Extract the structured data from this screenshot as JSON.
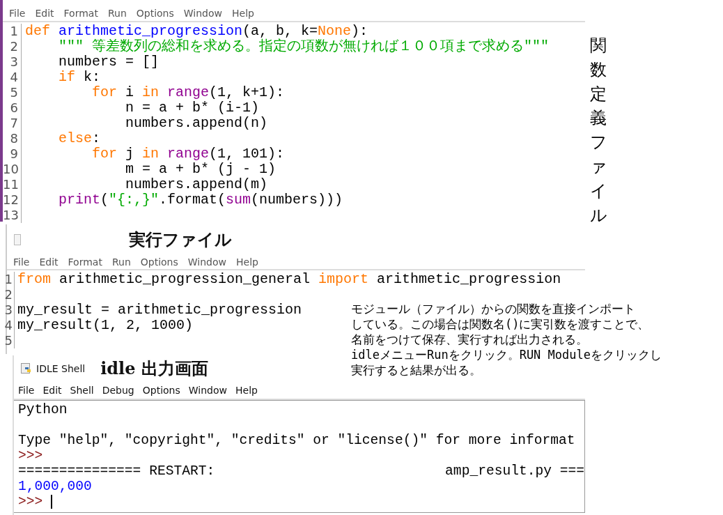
{
  "definition_window": {
    "menu": [
      "File",
      "Edit",
      "Format",
      "Run",
      "Options",
      "Window",
      "Help"
    ],
    "lines": [
      {
        "number": "1",
        "tokens": [
          {
            "kind": "keyword",
            "text": "def"
          },
          {
            "kind": "defname",
            "text": " arithmetic_progression"
          },
          {
            "kind": "plain",
            "text": "(a, b, k="
          },
          {
            "kind": "keyword",
            "text": "None"
          },
          {
            "kind": "plain",
            "text": "):"
          }
        ]
      },
      {
        "number": "2",
        "tokens": [
          {
            "kind": "string",
            "text": "    \"\"\" 等差数列の総和を求める。指定の項数が無ければ１００項まで求める\"\"\""
          }
        ]
      },
      {
        "number": "3",
        "tokens": [
          {
            "kind": "plain",
            "text": "    numbers = []"
          }
        ]
      },
      {
        "number": "4",
        "tokens": [
          {
            "kind": "keyword",
            "text": "    if"
          },
          {
            "kind": "plain",
            "text": " k:"
          }
        ]
      },
      {
        "number": "5",
        "tokens": [
          {
            "kind": "keyword",
            "text": "        for"
          },
          {
            "kind": "plain",
            "text": " i "
          },
          {
            "kind": "keyword",
            "text": "in"
          },
          {
            "kind": "builtin",
            "text": " range"
          },
          {
            "kind": "plain",
            "text": "(1, k+1):"
          }
        ]
      },
      {
        "number": "6",
        "tokens": [
          {
            "kind": "plain",
            "text": "            n = a + b* (i-1)"
          }
        ]
      },
      {
        "number": "7",
        "tokens": [
          {
            "kind": "plain",
            "text": "            numbers.append(n)"
          }
        ]
      },
      {
        "number": "8",
        "tokens": [
          {
            "kind": "keyword",
            "text": "    else"
          },
          {
            "kind": "plain",
            "text": ":"
          }
        ]
      },
      {
        "number": "9",
        "tokens": [
          {
            "kind": "keyword",
            "text": "        for"
          },
          {
            "kind": "plain",
            "text": " j "
          },
          {
            "kind": "keyword",
            "text": "in"
          },
          {
            "kind": "builtin",
            "text": " range"
          },
          {
            "kind": "plain",
            "text": "(1, 101):"
          }
        ]
      },
      {
        "number": "10",
        "tokens": [
          {
            "kind": "plain",
            "text": "            m = a + b* (j - 1)"
          }
        ]
      },
      {
        "number": "11",
        "tokens": [
          {
            "kind": "plain",
            "text": "            numbers.append(m)"
          }
        ]
      },
      {
        "number": "12",
        "tokens": [
          {
            "kind": "builtin",
            "text": "    print"
          },
          {
            "kind": "plain",
            "text": "("
          },
          {
            "kind": "string",
            "text": "\"{:,}\""
          },
          {
            "kind": "plain",
            "text": ".format("
          },
          {
            "kind": "builtin",
            "text": "sum"
          },
          {
            "kind": "plain",
            "text": "(numbers)))"
          }
        ]
      },
      {
        "number": "13"
      }
    ]
  },
  "definition_label": "関数定義ファイル",
  "run_window": {
    "title": "実行ファイル",
    "menu": [
      "File",
      "Edit",
      "Format",
      "Run",
      "Options",
      "Window",
      "Help"
    ],
    "lines": [
      {
        "number": "1",
        "tokens": [
          {
            "kind": "keyword",
            "text": "from"
          },
          {
            "kind": "plain",
            "text": " arithmetic_progression_general "
          },
          {
            "kind": "keyword",
            "text": "import"
          },
          {
            "kind": "plain",
            "text": " arithmetic_progression"
          }
        ]
      },
      {
        "number": "2"
      },
      {
        "number": "3",
        "tokens": [
          {
            "kind": "plain",
            "text": "my_result = arithmetic_progression"
          }
        ]
      },
      {
        "number": "4",
        "tokens": [
          {
            "kind": "plain",
            "text": "my_result(1, 2, 1000)"
          }
        ]
      },
      {
        "number": "5"
      }
    ]
  },
  "annotation": [
    "モジュール（ファイル）からの関数を直接インポート",
    "している。この場合は関数名()に実引数を渡すことで、",
    "名前をつけて保存、実行すれば出力される。",
    "idleメニューRunをクリック。RUN Moduleをクリックし",
    "実行すると結果が出る。"
  ],
  "shell_window": {
    "app_title": "IDLE Shell",
    "title": "idle 出力画面",
    "menu": [
      "File",
      "Edit",
      "Shell",
      "Debug",
      "Options",
      "Window",
      "Help"
    ],
    "lines": [
      {
        "kind": "text",
        "text": "Python"
      },
      {
        "kind": "blank"
      },
      {
        "kind": "text",
        "text": "Type \"help\", \"copyright\", \"credits\" or \"license()\" for more informat"
      },
      {
        "kind": "prompt",
        "text": ">>>"
      },
      {
        "kind": "split",
        "text": "=============== RESTART:",
        "text_right": "amp_result.py ==="
      },
      {
        "kind": "output",
        "text": "1,000,000"
      },
      {
        "kind": "prompt",
        "text": ">>>",
        "cursor": true
      }
    ]
  }
}
